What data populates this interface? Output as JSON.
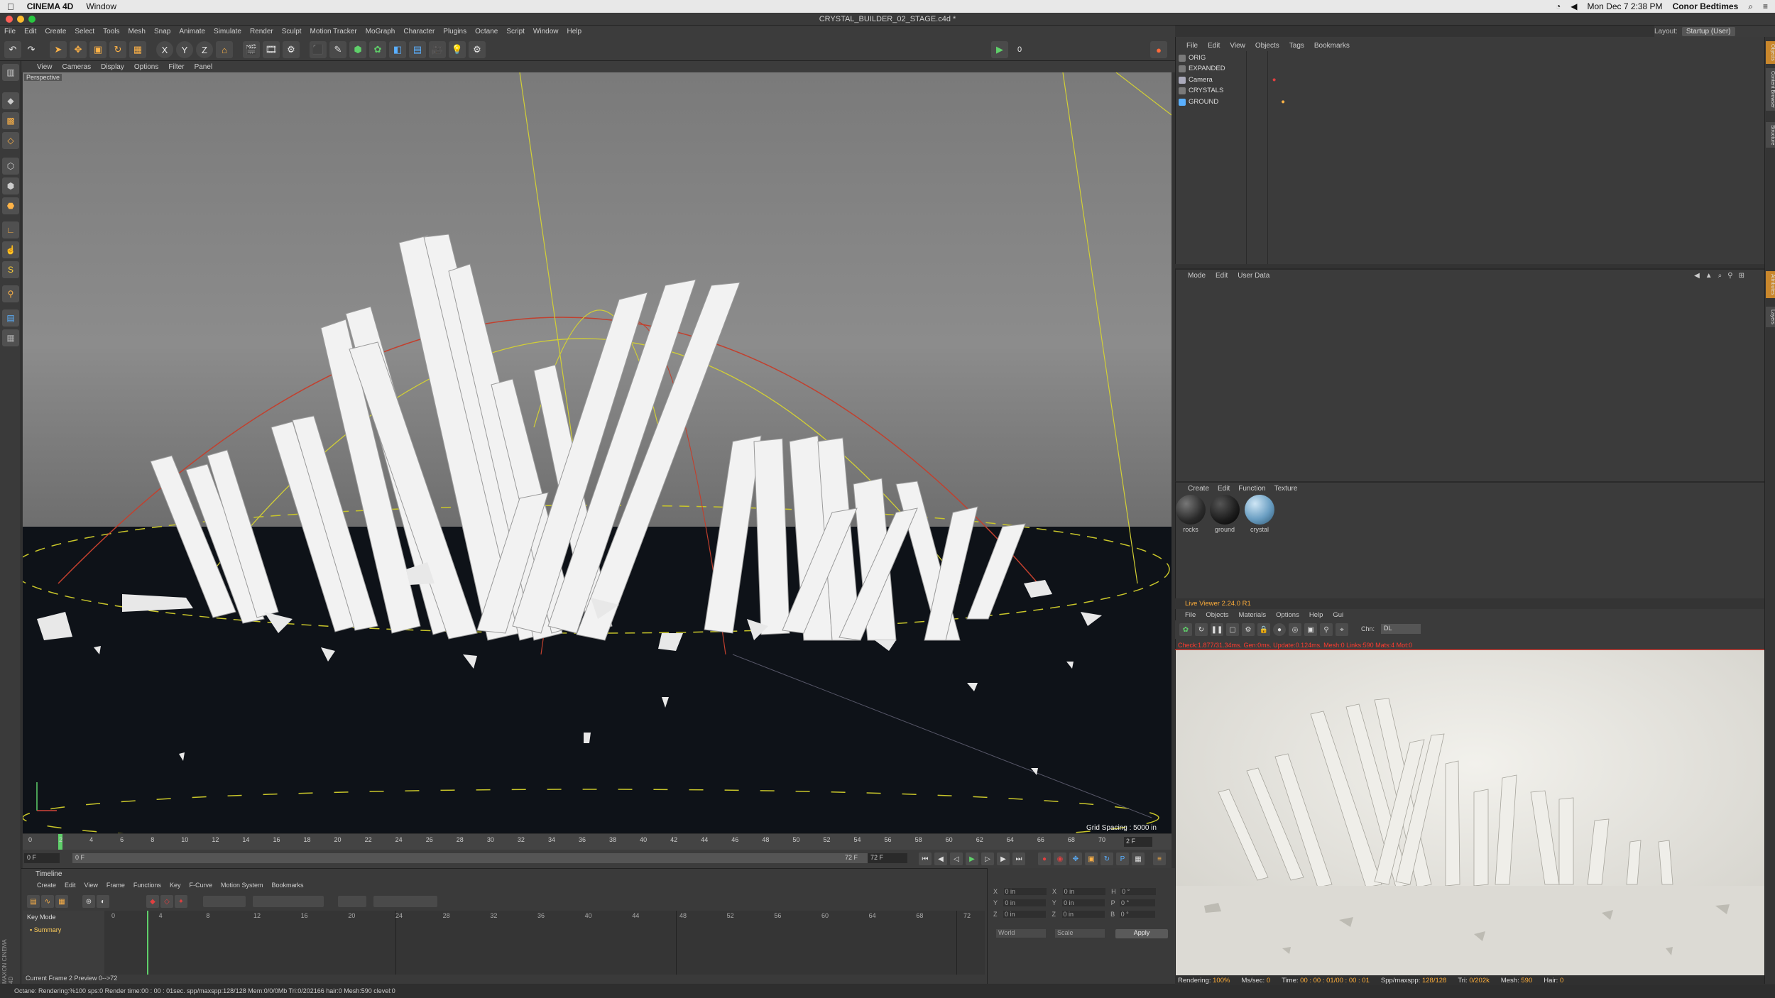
{
  "mac_menubar": {
    "app_name": "CINEMA 4D",
    "window_menu": "Window",
    "datetime": "Mon Dec 7  2:38 PM",
    "user": "Conor Bedtimes"
  },
  "window_title": "CRYSTAL_BUILDER_02_STAGE.c4d *",
  "main_menu": [
    "File",
    "Edit",
    "Create",
    "Select",
    "Tools",
    "Mesh",
    "Snap",
    "Animate",
    "Simulate",
    "Render",
    "Sculpt",
    "Motion Tracker",
    "MoGraph",
    "Character",
    "Plugins",
    "Octane",
    "Script",
    "Window",
    "Help"
  ],
  "layout": {
    "label": "Layout:",
    "value": "Startup (User)"
  },
  "toolbar": {
    "x_axis": "X",
    "y_axis": "Y",
    "z_axis": "Z",
    "frame_badge": "0"
  },
  "viewport": {
    "menu": [
      "View",
      "Cameras",
      "Display",
      "Options",
      "Filter",
      "Panel"
    ],
    "label": "Perspective",
    "grid_spacing": "Grid Spacing : 5000 in"
  },
  "ruler_ticks": [
    "0",
    "2",
    "4",
    "6",
    "8",
    "10",
    "12",
    "14",
    "16",
    "18",
    "20",
    "22",
    "24",
    "26",
    "28",
    "30",
    "32",
    "34",
    "36",
    "38",
    "40",
    "42",
    "44",
    "46",
    "48",
    "50",
    "52",
    "54",
    "56",
    "58",
    "60",
    "62",
    "64",
    "66",
    "68",
    "70",
    "72"
  ],
  "ruler_end_field": "2 F",
  "playback": {
    "current_field": "0 F",
    "start_field": "0 F",
    "end_field": "72 F",
    "end_field2": "72 F"
  },
  "timeline": {
    "title": "Timeline",
    "menu": [
      "Create",
      "Edit",
      "View",
      "Frame",
      "Functions",
      "Key",
      "F-Curve",
      "Motion System",
      "Bookmarks"
    ],
    "key_mode": "Key Mode",
    "summary": "Summary",
    "ticks": [
      "0",
      "4",
      "8",
      "12",
      "16",
      "20",
      "24",
      "28",
      "32",
      "36",
      "40",
      "44",
      "48",
      "52",
      "56",
      "60",
      "64",
      "68",
      "72"
    ],
    "footer": "Current Frame  2  Preview  0-->72"
  },
  "coords": {
    "rows": [
      {
        "a": "X",
        "av": "0 in",
        "b": "X",
        "bv": "0 in",
        "c": "H",
        "cv": "0 °"
      },
      {
        "a": "Y",
        "av": "0 in",
        "b": "Y",
        "bv": "0 in",
        "c": "P",
        "cv": "0 °"
      },
      {
        "a": "Z",
        "av": "0 in",
        "b": "Z",
        "bv": "0 in",
        "c": "B",
        "cv": "0 °"
      }
    ],
    "world": "World",
    "scale": "Scale",
    "apply": "Apply"
  },
  "status_bar": "Octane: Rendering:%100 sps:0 Render time:00 : 00 : 01sec. spp/maxspp:128/128 Mem:0/0/0Mb Tri:0/202166 hair:0 Mesh:590 clevel:0",
  "object_manager": {
    "menu": [
      "File",
      "Edit",
      "View",
      "Objects",
      "Tags",
      "Bookmarks"
    ],
    "objects": [
      "ORIG",
      "EXPANDED",
      "Camera",
      "CRYSTALS",
      "GROUND"
    ]
  },
  "attributes": {
    "menu": [
      "Mode",
      "Edit",
      "User Data"
    ]
  },
  "materials": {
    "menu": [
      "Create",
      "Edit",
      "Function",
      "Texture"
    ],
    "items": [
      {
        "name": "rocks",
        "color": "#2a2a2a"
      },
      {
        "name": "ground",
        "color": "#1b1b1b"
      },
      {
        "name": "crystal",
        "color": "#6a9ec2"
      }
    ]
  },
  "live_viewer": {
    "title": "Live Viewer 2.24.0 R1",
    "menu": [
      "File",
      "Objects",
      "Materials",
      "Options",
      "Help",
      "Gui"
    ],
    "channel_label": "Chn:",
    "channel_value": "DL",
    "check_text": "Check:1.877/31.34ms. Gen:0ms. Update:0.124ms. Mesh:0 Links:590 Mats:4 Mot:0",
    "status": [
      {
        "k": "Rendering:",
        "v": "100%"
      },
      {
        "k": "Ms/sec:",
        "v": "0"
      },
      {
        "k": "Time:",
        "v": "00 : 00 : 01/00 : 00 : 01"
      },
      {
        "k": "Spp/maxspp:",
        "v": "128/128"
      },
      {
        "k": "Tri:",
        "v": "0/202k"
      },
      {
        "k": "Mesh:",
        "v": "590"
      },
      {
        "k": "Hair:",
        "v": "0"
      }
    ]
  },
  "right_tabs": [
    "Objects",
    "Content Browser",
    "Structure",
    "Attributes",
    "Layers"
  ],
  "colors": {
    "accent": "#ffae3a",
    "ui_dark": "#3b3b3b",
    "viewport_sky": "#838383",
    "ground": "#0d1117",
    "render_bg": "#e4e2dc"
  }
}
